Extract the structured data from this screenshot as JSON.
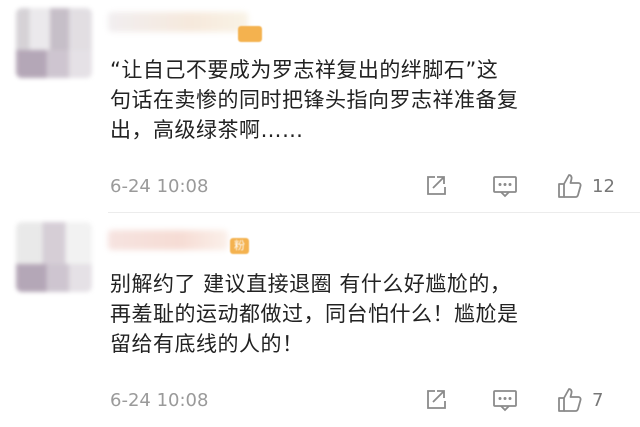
{
  "comments": [
    {
      "lines": [
        "“让自己不要成为罗志祥复出的绊脚石”这",
        "句话在卖惨的同时把锋头指向罗志祥准备复",
        "出，高级绿茶啊……"
      ],
      "time": "6-24 10:08",
      "likes": "12",
      "badge": ""
    },
    {
      "lines": [
        "别解约了 建议直接退圈 有什么好尴尬的，",
        "再羞耻的运动都做过，同台怕什么！尴尬是",
        "留给有底线的人的！"
      ],
      "time": "6-24 10:08",
      "likes": "7",
      "badge": "粉"
    }
  ],
  "icons": {
    "share": "share-icon",
    "reply": "reply-icon",
    "like": "thumbs-up-icon"
  },
  "colors": {
    "text": "#222222",
    "meta": "#9a9a9a",
    "badge": "#f4b24f"
  }
}
